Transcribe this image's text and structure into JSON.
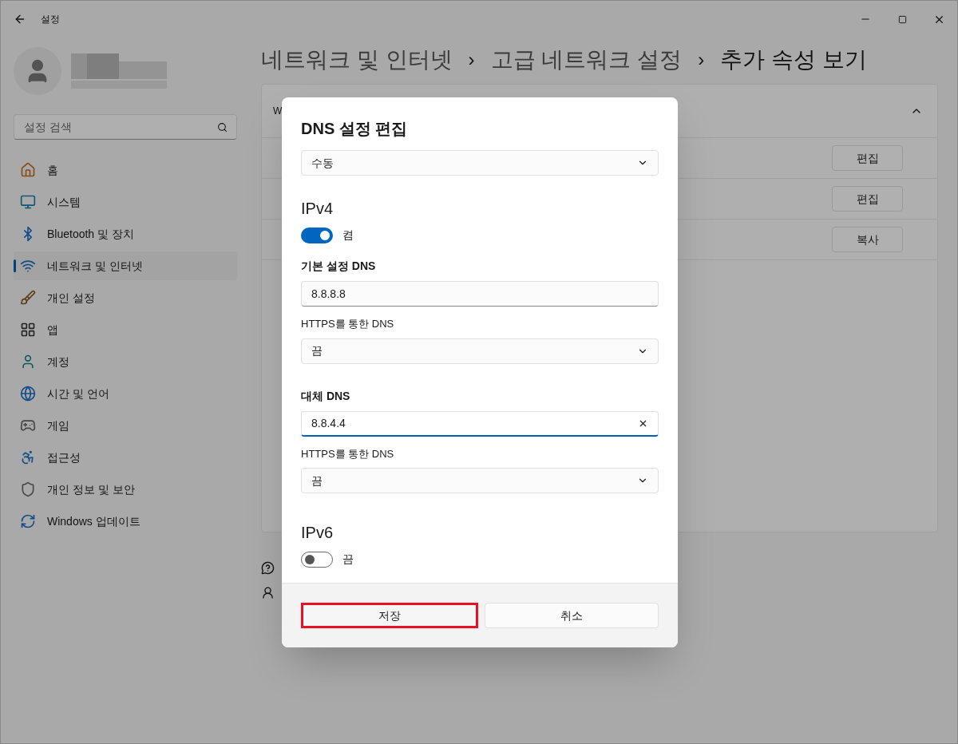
{
  "window": {
    "title": "설정"
  },
  "sidebar": {
    "search": {
      "placeholder": "설정 검색"
    },
    "items": [
      {
        "label": "홈",
        "selected": false
      },
      {
        "label": "시스템",
        "selected": false
      },
      {
        "label": "Bluetooth 및 장치",
        "selected": false
      },
      {
        "label": "네트워크 및 인터넷",
        "selected": true
      },
      {
        "label": "개인 설정",
        "selected": false
      },
      {
        "label": "앱",
        "selected": false
      },
      {
        "label": "계정",
        "selected": false
      },
      {
        "label": "시간 및 언어",
        "selected": false
      },
      {
        "label": "게임",
        "selected": false
      },
      {
        "label": "접근성",
        "selected": false
      },
      {
        "label": "개인 정보 및 보안",
        "selected": false
      },
      {
        "label": "Windows 업데이트",
        "selected": false
      }
    ]
  },
  "breadcrumb": {
    "separator": "›",
    "items": [
      "네트워크 및 인터넷",
      "고급 네트워크 설정",
      "추가 속성 보기"
    ]
  },
  "card": {
    "header": "W",
    "buttons": [
      "편집",
      "편집",
      "복사"
    ]
  },
  "dialog": {
    "title": "DNS 설정 편집",
    "mode": "수동",
    "ipv4": {
      "heading": "IPv4",
      "on": true,
      "state": "켬",
      "fields": [
        {
          "label": "기본 설정 DNS",
          "value": "8.8.8.8",
          "focused": false,
          "https_label": "HTTPS를 통한 DNS",
          "https_value": "끔"
        },
        {
          "label": "대체 DNS",
          "value": "8.8.4.4",
          "focused": true,
          "https_label": "HTTPS를 통한 DNS",
          "https_value": "끔"
        }
      ]
    },
    "ipv6": {
      "heading": "IPv6",
      "on": false,
      "state": "끔"
    },
    "buttons": [
      {
        "label": "저장",
        "highlighted": true
      },
      {
        "label": "취소",
        "highlighted": false
      }
    ]
  }
}
